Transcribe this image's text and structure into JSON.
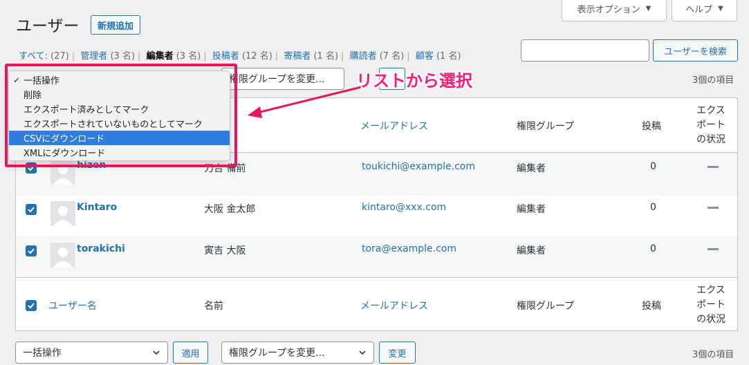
{
  "header": {
    "title": "ユーザー",
    "add_new_label": "新規追加",
    "screen_options_label": "表示オプション",
    "help_label": "ヘルプ"
  },
  "filters": {
    "all": {
      "label": "すべて",
      "count": "(27)"
    },
    "admin": {
      "label": "管理者",
      "count": "(3 名)"
    },
    "editor": {
      "label": "編集者",
      "count": "(3 名)"
    },
    "author": {
      "label": "投稿者",
      "count": "(12 名)"
    },
    "contributor": {
      "label": "寄稿者",
      "count": "(1 名)"
    },
    "subscriber": {
      "label": "購読者",
      "count": "(7 名)"
    },
    "customer": {
      "label": "顧客",
      "count": "(1 名)"
    }
  },
  "search": {
    "value": "",
    "button_label": "ユーザーを検索"
  },
  "top_actions": {
    "role_select": "権限グループを変更...",
    "items_count": "3個の項目"
  },
  "bottom_actions": {
    "bulk_select": "一括操作",
    "apply_label": "適用",
    "role_select": "権限グループを変更...",
    "change_label": "変更",
    "items_count": "3個の項目"
  },
  "bulk_dropdown": {
    "items": [
      "一括操作",
      "削除",
      "エクスポート済みとしてマーク",
      "エクスポートされていないものとしてマーク",
      "CSVにダウンロード",
      "XMLにダウンロード"
    ],
    "selected_index": 0,
    "highlighted_index": 4
  },
  "table": {
    "columns": {
      "username": "ユーザー名",
      "name": "名前",
      "email": "メールアドレス",
      "role": "権限グループ",
      "posts": "投稿",
      "export_status": [
        "エクス",
        "ポート",
        "の状況"
      ]
    },
    "rows": [
      {
        "username": "hizen",
        "name": "刀吉 備前",
        "email": "toukichi@example.com",
        "role": "編集者",
        "posts": "0"
      },
      {
        "username": "Kintaro",
        "name": "大阪 金太郎",
        "email": "kintaro@xxx.com",
        "role": "編集者",
        "posts": "0"
      },
      {
        "username": "torakichi",
        "name": "寅吉 大阪",
        "email": "tora@example.com",
        "role": "編集者",
        "posts": "0"
      }
    ]
  },
  "annotation": {
    "label": "リストから選択",
    "color": "#e6175c"
  }
}
